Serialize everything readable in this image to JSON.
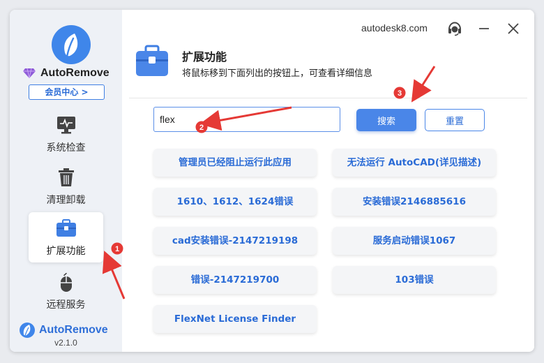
{
  "app": {
    "brand": "AutoRemove",
    "member_center": "会员中心 >",
    "version": "v2.1.0",
    "site": "autodesk8.com"
  },
  "sidebar": {
    "items": [
      {
        "label": "系统检查",
        "icon": "monitor-icon"
      },
      {
        "label": "清理卸载",
        "icon": "trash-icon"
      },
      {
        "label": "扩展功能",
        "icon": "toolbox-icon",
        "active": true
      },
      {
        "label": "远程服务",
        "icon": "mouse-icon"
      }
    ]
  },
  "page": {
    "title": "扩展功能",
    "subtitle": "将鼠标移到下面列出的按钮上，可查看详细信息"
  },
  "search": {
    "value": "flex",
    "search_label": "搜索",
    "reset_label": "重置"
  },
  "issues": [
    "管理员已经阻止运行此应用",
    "无法运行 AutoCAD(详见描述)",
    "1610、1612、1624错误",
    "安装错误2146885616",
    "cad安装错误-2147219198",
    "服务启动错误1067",
    "错误-2147219700",
    "103错误",
    "FlexNet License Finder"
  ],
  "annotations": [
    "1",
    "2",
    "3"
  ],
  "colors": {
    "accent": "#4a86e8",
    "link": "#2a6bd6",
    "annotation": "#e53935",
    "sidebar_bg": "#eef1f6"
  }
}
